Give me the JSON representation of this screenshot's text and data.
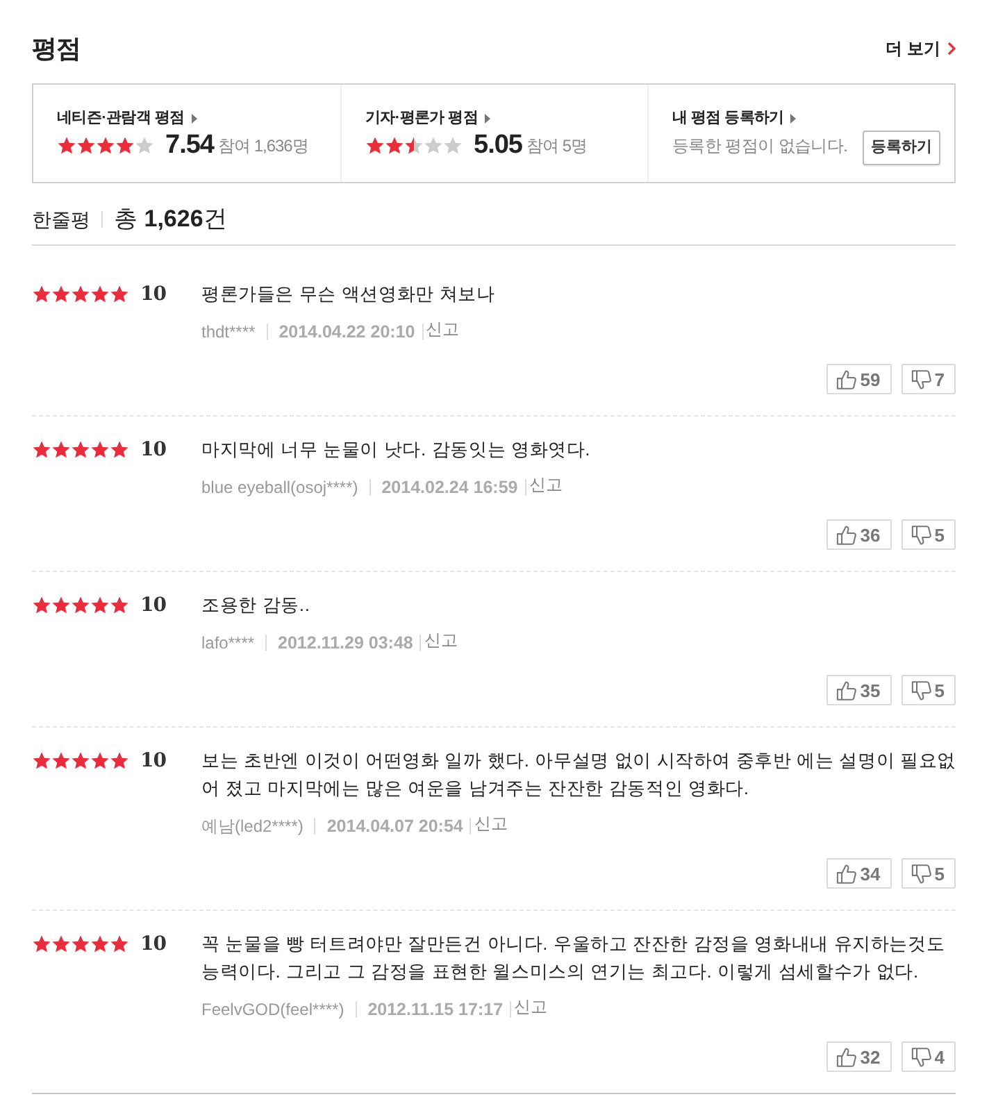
{
  "header": {
    "title": "평점",
    "more": "더 보기"
  },
  "summary": [
    {
      "kind": "rating",
      "label": "네티즌·관람객 평점",
      "stars": 4,
      "score": "7.54",
      "participants": "참여 1,636명"
    },
    {
      "kind": "rating",
      "label": "기자·평론가 평점",
      "stars": 2.5,
      "score": "5.05",
      "participants": "참여 5명"
    },
    {
      "kind": "register",
      "label": "내 평점 등록하기",
      "message": "등록한 평점이 없습니다.",
      "button": "등록하기"
    }
  ],
  "reviews_header": {
    "title": "한줄평",
    "total": "총 **1,626**건"
  },
  "reviews": [
    {
      "stars": 5,
      "score": "10",
      "text": "평론가들은 무슨 액션영화만 쳐보나",
      "author": "thdt****",
      "date": "2014.04.22 20:10",
      "report": "신고",
      "likes": "59",
      "dislikes": "7"
    },
    {
      "stars": 5,
      "score": "10",
      "text": "마지막에 너무 눈물이 낫다. 감동잇는 영화엿다.",
      "author": "blue eyeball(osoj****)",
      "date": "2014.02.24 16:59",
      "report": "신고",
      "likes": "36",
      "dislikes": "5"
    },
    {
      "stars": 5,
      "score": "10",
      "text": "조용한 감동..",
      "author": "lafo****",
      "date": "2012.11.29 03:48",
      "report": "신고",
      "likes": "35",
      "dislikes": "5"
    },
    {
      "stars": 5,
      "score": "10",
      "text": "보는 초반엔 이것이 어떤영화 일까 했다. 아무설명 없이 시작하여 중후반 에는 설명이 필요없어 졌고 마지막에는 많은 여운을 남겨주는 잔잔한 감동적인 영화다.",
      "author": "예남(led2****)",
      "date": "2014.04.07 20:54",
      "report": "신고",
      "likes": "34",
      "dislikes": "5"
    },
    {
      "stars": 5,
      "score": "10",
      "text": "꼭 눈물을 빵 터트려야만 잘만든건 아니다. 우울하고 잔잔한 감정을 영화내내 유지하는것도 능력이다. 그리고 그 감정을 표현한 윌스미스의 연기는 최고다. 이렇게 섬세할수가 없다.",
      "author": "FeelvGOD(feel****)",
      "date": "2012.11.15 17:17",
      "report": "신고",
      "likes": "32",
      "dislikes": "4"
    }
  ]
}
